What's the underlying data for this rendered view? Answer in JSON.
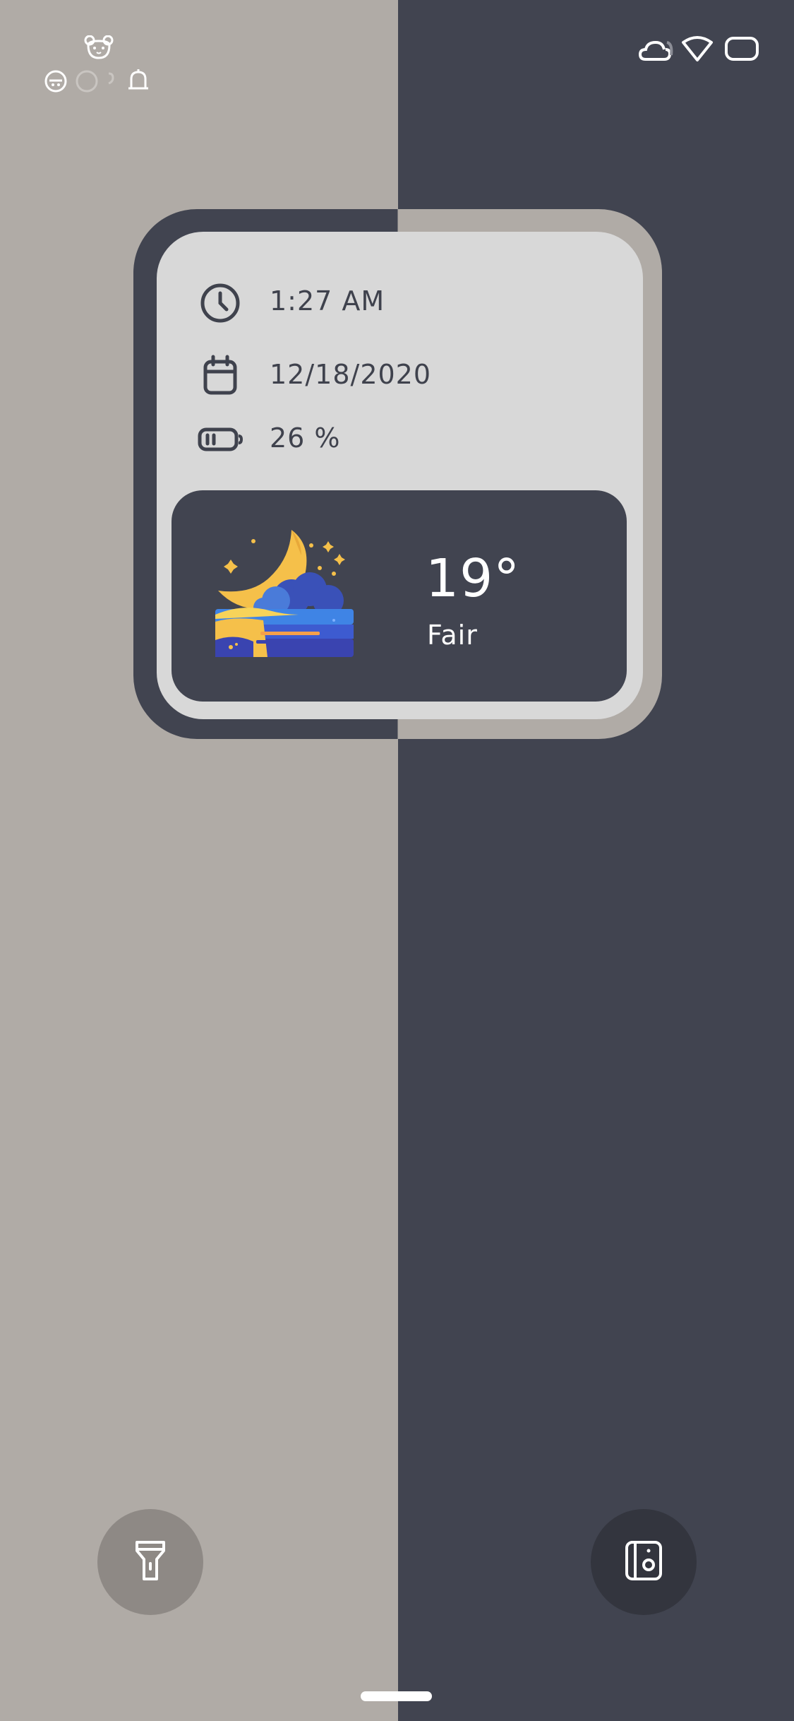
{
  "status_bar": {
    "left_icons": [
      "bear-face-icon",
      "face-circle-icon",
      "circle-icon",
      "notification-bell-icon"
    ],
    "right_icons": [
      "cloud-icon",
      "wifi-icon",
      "battery-icon"
    ]
  },
  "widget": {
    "time": "1:27 AM",
    "date": "12/18/2020",
    "battery": "26 %",
    "icons": {
      "time": "clock-icon",
      "date": "calendar-icon",
      "battery": "battery-low-icon"
    }
  },
  "weather": {
    "temperature": "19°",
    "condition": "Fair",
    "illustration": "moon-clouds-night-icon"
  },
  "shortcuts": {
    "left": "flashlight-icon",
    "right": "camera-icon"
  },
  "colors": {
    "light_bg": "#b0aba6",
    "dark_bg": "#414450",
    "widget_inner": "#d8d8d8",
    "text_dark": "#3f424d",
    "moon_yellow": "#f5c04a",
    "cloud_blue": "#4a7bd9"
  }
}
